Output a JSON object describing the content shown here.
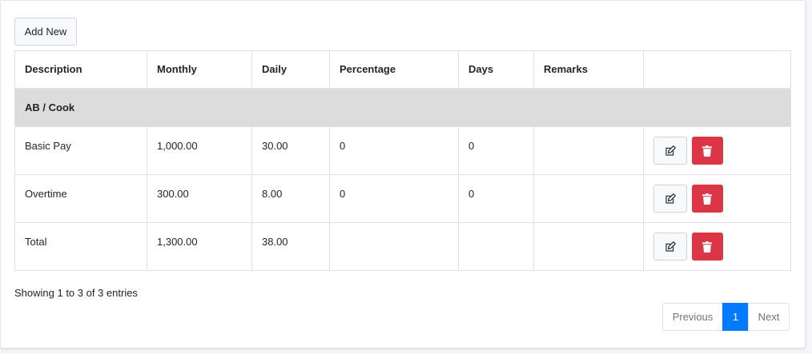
{
  "toolbar": {
    "add_new_label": "Add New"
  },
  "table": {
    "columns": [
      "Description",
      "Monthly",
      "Daily",
      "Percentage",
      "Days",
      "Remarks",
      ""
    ],
    "group_label": "AB / Cook",
    "rows": [
      {
        "description": "Basic Pay",
        "monthly": "1,000.00",
        "daily": "30.00",
        "percentage": "0",
        "days": "0",
        "remarks": ""
      },
      {
        "description": "Overtime",
        "monthly": "300.00",
        "daily": "8.00",
        "percentage": "0",
        "days": "0",
        "remarks": ""
      },
      {
        "description": "Total",
        "monthly": "1,300.00",
        "daily": "38.00",
        "percentage": "",
        "days": "",
        "remarks": ""
      }
    ]
  },
  "footer": {
    "info": "Showing 1 to 3 of 3 entries",
    "pagination": {
      "previous": "Previous",
      "current": "1",
      "next": "Next"
    }
  },
  "icons": {
    "edit": "edit-icon",
    "delete": "trash-icon"
  },
  "colors": {
    "primary": "#007bff",
    "danger": "#dc3545",
    "group_bg": "#dcdcdc"
  }
}
